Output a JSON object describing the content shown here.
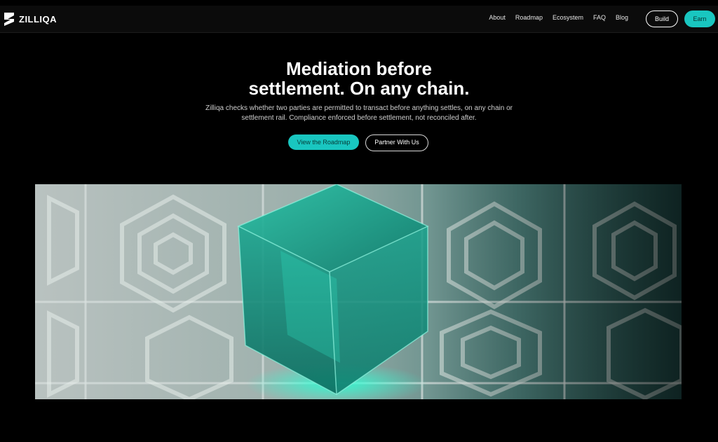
{
  "header": {
    "brand": "ZILLIQA",
    "nav": [
      "About",
      "Roadmap",
      "Ecosystem",
      "FAQ",
      "Blog"
    ],
    "build_label": "Build",
    "earn_label": "Earn"
  },
  "hero": {
    "title_line1": "Mediation before",
    "title_line2": "settlement. On any chain.",
    "subtitle_line1": "Zilliqa checks whether two parties are permitted to transact before anything settles, on any chain or",
    "subtitle_line2": "settlement rail. Compliance enforced before settlement, not reconciled after.",
    "cta_primary": "View the Roadmap",
    "cta_secondary": "Partner With Us"
  },
  "colors": {
    "accent": "#19c6c0",
    "background": "#000000"
  },
  "icons": {
    "logo": "zilliqa-logo-icon"
  }
}
